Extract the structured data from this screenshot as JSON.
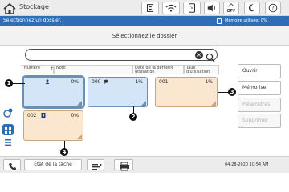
{
  "topbar": {
    "title": "Stockage",
    "energy_label": "OFF"
  },
  "infobar": {
    "message": "Sélectionnez un dossier.",
    "memory_label": "Mémoire utilisée: 0%"
  },
  "header": {
    "title": "Sélectionnez le dossier"
  },
  "search": {
    "value": "",
    "clear_label": "×"
  },
  "columns": [
    {
      "label": "Numéro"
    },
    {
      "label": "Nom"
    },
    {
      "label": "Date de la dernière utilisation"
    },
    {
      "label": "Taux d'utilisation"
    }
  ],
  "folders": [
    {
      "number": "",
      "percent": "0%",
      "icon": "user-icon"
    },
    {
      "number": "000",
      "percent": "1%",
      "icon": "comment-icon"
    },
    {
      "number": "001",
      "percent": "1%",
      "icon": ""
    },
    {
      "number": "002",
      "percent": "0%",
      "icon": "lock-icon"
    }
  ],
  "callouts": [
    "1",
    "2",
    "3",
    "4"
  ],
  "actions": {
    "open": "Ouvrir",
    "save": "Mémoriser",
    "settings": "Paramètres",
    "delete": "Supprimer"
  },
  "bottombar": {
    "job_status": "État de la tâche",
    "datetime": "04-28-2020 10:54 AM"
  },
  "colors": {
    "accent": "#2f6db5",
    "folder_blue": "#d3e5f6",
    "folder_peach": "#fbe7d0"
  }
}
